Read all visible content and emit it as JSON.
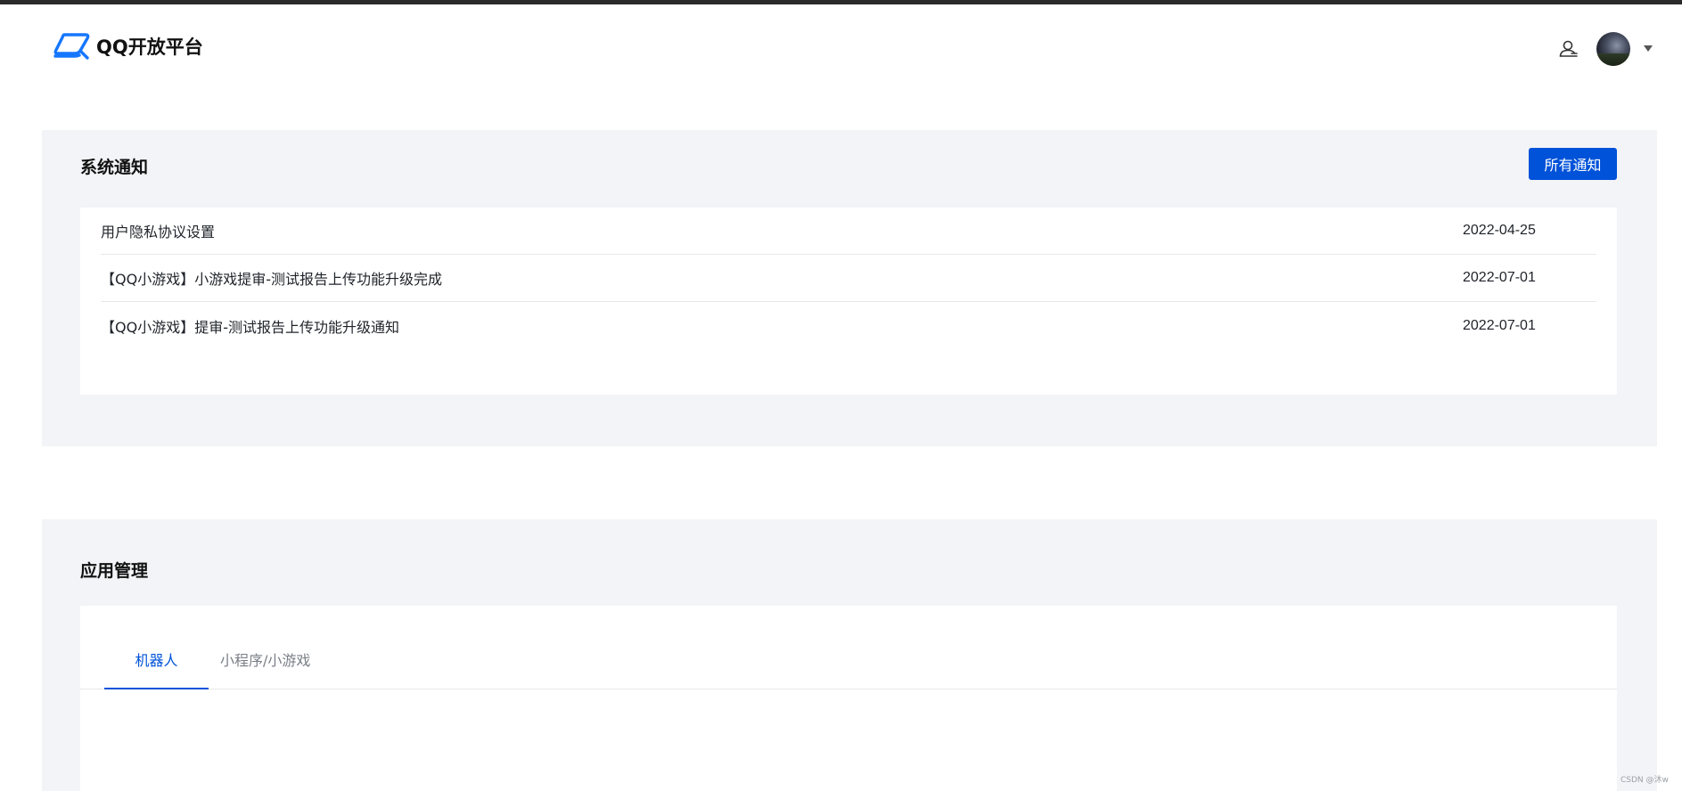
{
  "header": {
    "logo_text": "QQ开放平台",
    "icons": {
      "logo": "qq-open-platform-logo-icon",
      "user": "user-switch-icon",
      "avatar": "avatar",
      "dropdown": "caret-down-icon"
    }
  },
  "notices": {
    "title": "系统通知",
    "all_button": "所有通知",
    "items": [
      {
        "title": "用户隐私协议设置",
        "date": "2022-04-25"
      },
      {
        "title": "【QQ小游戏】小游戏提审-测试报告上传功能升级完成",
        "date": "2022-07-01"
      },
      {
        "title": "【QQ小游戏】提审-测试报告上传功能升级通知",
        "date": "2022-07-01"
      }
    ]
  },
  "apps": {
    "title": "应用管理",
    "tabs": [
      {
        "label": "机器人",
        "active": true
      },
      {
        "label": "小程序/小游戏",
        "active": false
      }
    ]
  },
  "watermark": "CSDN @沐w",
  "colors": {
    "accent": "#0052d9",
    "section_bg": "#f3f4f7",
    "topbar": "#2b2b2b"
  }
}
